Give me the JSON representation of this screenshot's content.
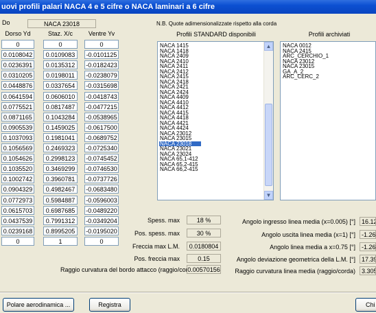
{
  "window": {
    "title": "uovi profili palari NACA 4 e 5 cifre o NACA laminari a 6 cifre"
  },
  "profile": {
    "label": "Do",
    "value": "NACA 23018"
  },
  "note": "N.B. Quote adimensionalizzate rispetto alla corda",
  "columns": {
    "dorso": "Dorso Yd",
    "staz": "Staz. X/c",
    "ventre": "Ventre Yv"
  },
  "table_rows": [
    [
      "0",
      "0",
      "0"
    ],
    [
      "0.0108042",
      "0.0109083",
      "-0.0101125"
    ],
    [
      "0.0236391",
      "0.0135312",
      "-0.0182423"
    ],
    [
      "0.0310205",
      "0.0198011",
      "-0.0238079"
    ],
    [
      "0.0448876",
      "0.0337654",
      "-0.0315698"
    ],
    [
      "0.0641594",
      "0.0606010",
      "-0.0418743"
    ],
    [
      "0.0775521",
      "0.0817487",
      "-0.0477215"
    ],
    [
      "0.0871165",
      "0.1043284",
      "-0.0538965"
    ],
    [
      "0.0905539",
      "0.1459025",
      "-0.0617500"
    ],
    [
      "0.1037093",
      "0.1981041",
      "-0.0689752"
    ],
    [
      "0.1056569",
      "0.2469323",
      "-0.0725340"
    ],
    [
      "0.1054626",
      "0.2998123",
      "-0.0745452"
    ],
    [
      "0.1035520",
      "0.3469299",
      "-0.0746530"
    ],
    [
      "0.1002742",
      "0.3960781",
      "-0.0737726"
    ],
    [
      "0.0904329",
      "0.4982467",
      "-0.0683480"
    ],
    [
      "0.0772973",
      "0.5984887",
      "-0.0596003"
    ],
    [
      "0.0615703",
      "0.6987685",
      "-0.0489220"
    ],
    [
      "0.0437539",
      "0.7991312",
      "-0.0349204"
    ],
    [
      "0.0239168",
      "0.8995205",
      "-0.0195020"
    ],
    [
      "0",
      "1",
      "0"
    ]
  ],
  "standard_list": {
    "title": "Profili STANDARD disponibili",
    "items": [
      "NACA 1415",
      "NACA 1418",
      "NACA 2409",
      "NACA 2410",
      "NACA 2411",
      "NACA 2412",
      "NACA 2415",
      "NACA 2418",
      "NACA 2421",
      "NACA 2424",
      "NACA 4409",
      "NACA 4410",
      "NACA 4412",
      "NACA 4415",
      "NACA 4418",
      "NACA 4421",
      "NACA 4424",
      "NACA 23012",
      "NACA 23015",
      "NACA 23018",
      "NACA 23021",
      "NACA 23024",
      "NACA 65,1-412",
      "NACA 65,2-415",
      "NACA 66,2-415"
    ],
    "selected": "NACA 23018"
  },
  "archived_list": {
    "title": "Profili archiviati",
    "items": [
      "NACA 0012",
      "NACA 2415",
      "ARC_CERCHIO_1",
      "NACA 23012",
      "NACA 23015",
      "GA_A_2",
      "ARC_CERC_2"
    ]
  },
  "params_left": [
    {
      "label": "Spess. max",
      "value": "18 %"
    },
    {
      "label": "Pos. spess. max",
      "value": "30 %"
    },
    {
      "label": "Freccia max L.M.",
      "value": "0.0180804"
    },
    {
      "label": "Pos. freccia max",
      "value": "0.15"
    }
  ],
  "leading_radius": {
    "label": "Raggio curvatura del bordo attacco (raggio/corda)",
    "value": "0.00570156"
  },
  "params_right": [
    {
      "label": "Angolo ingresso linea media (x=0.005)  [°]",
      "value": "16.12"
    },
    {
      "label": "Angolo uscita linea media (x=1)  [°]",
      "value": "-1.265"
    },
    {
      "label": "Angolo linea media a x=0.75  [°]",
      "value": "-1.265"
    },
    {
      "label": "Angolo deviazione geometrica della L.M.  [°]",
      "value": "17.39"
    },
    {
      "label": "Raggio curvatura linea media (raggio/corda)",
      "value": "3.305"
    }
  ],
  "buttons": {
    "polare": "Polare aerodinamica ...",
    "registra": "Registra",
    "chiudi": "Chi"
  },
  "colors": {
    "titlebar": "#0b4fd1",
    "selection": "#316ac5",
    "background": "#ece9d8"
  }
}
